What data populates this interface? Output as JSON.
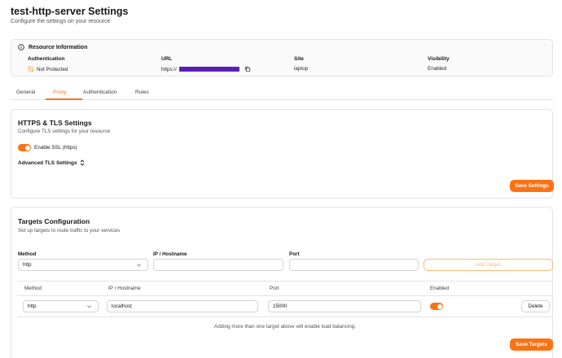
{
  "page": {
    "title": "test-http-server Settings",
    "subtitle": "Configure the settings on your resource"
  },
  "resource": {
    "heading": "Resource Information",
    "authentication": {
      "label": "Authentication",
      "value": "Not Protected"
    },
    "url": {
      "label": "URL",
      "value": "https://"
    },
    "site": {
      "label": "Site",
      "value": "laptop"
    },
    "visibility": {
      "label": "Visibility",
      "value": "Enabled"
    }
  },
  "tabs": [
    {
      "label": "General",
      "active": false
    },
    {
      "label": "Proxy",
      "active": true
    },
    {
      "label": "Authentication",
      "active": false
    },
    {
      "label": "Rules",
      "active": false
    }
  ],
  "tls": {
    "title": "HTTPS & TLS Settings",
    "subtitle": "Configure TLS settings for your resource",
    "ssl_label": "Enable SSL (https)",
    "ssl_enabled": true,
    "advanced_label": "Advanced TLS Settings",
    "save_label": "Save Settings"
  },
  "targets": {
    "title": "Targets Configuration",
    "subtitle": "Set up targets to route traffic to your services",
    "form": {
      "method_label": "Method",
      "method_value": "http",
      "host_label": "IP / Hostname",
      "host_value": "",
      "port_label": "Port",
      "port_value": "",
      "add_label": "Add Target"
    },
    "columns": [
      "Method",
      "IP / Hostname",
      "Port",
      "Enabled"
    ],
    "rows": [
      {
        "method": "http",
        "host": "localhost",
        "port": "15000",
        "enabled": true,
        "delete_label": "Delete"
      }
    ],
    "hint": "Adding more than one target above will enable load balancing.",
    "save_label": "Save Targets"
  },
  "colors": {
    "accent": "#f97316",
    "warning": "#f5a524",
    "border": "#e4e4e7",
    "redaction": "#5b1fb8"
  }
}
